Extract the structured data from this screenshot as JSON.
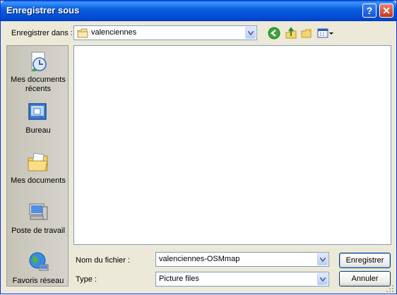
{
  "window": {
    "title": "Enregistrer sous",
    "help_label": "?",
    "close_label": "✕"
  },
  "location": {
    "label": "Enregistrer dans :",
    "current_folder": "valenciennes"
  },
  "toolbar": {
    "icons": [
      "back-icon",
      "up-folder-icon",
      "new-folder-icon",
      "view-menu-icon"
    ]
  },
  "places": [
    {
      "label_line1": "Mes documents",
      "label_line2": "récents",
      "icon": "recent-documents-icon"
    },
    {
      "label_line1": "Bureau",
      "label_line2": "",
      "icon": "desktop-icon"
    },
    {
      "label_line1": "Mes documents",
      "label_line2": "",
      "icon": "my-documents-icon"
    },
    {
      "label_line1": "Poste de travail",
      "label_line2": "",
      "icon": "my-computer-icon"
    },
    {
      "label_line1": "Favoris réseau",
      "label_line2": "",
      "icon": "network-places-icon"
    }
  ],
  "form": {
    "filename_label": "Nom du fichier :",
    "filename_value": "valenciennes-OSMmap",
    "type_label": "Type :",
    "type_value": "Picture files"
  },
  "buttons": {
    "save": "Enregistrer",
    "cancel": "Annuler"
  },
  "colors": {
    "titlebar": "#0a5fdc",
    "dialog_bg": "#ece9d8",
    "border_blue": "#7f9db9"
  }
}
